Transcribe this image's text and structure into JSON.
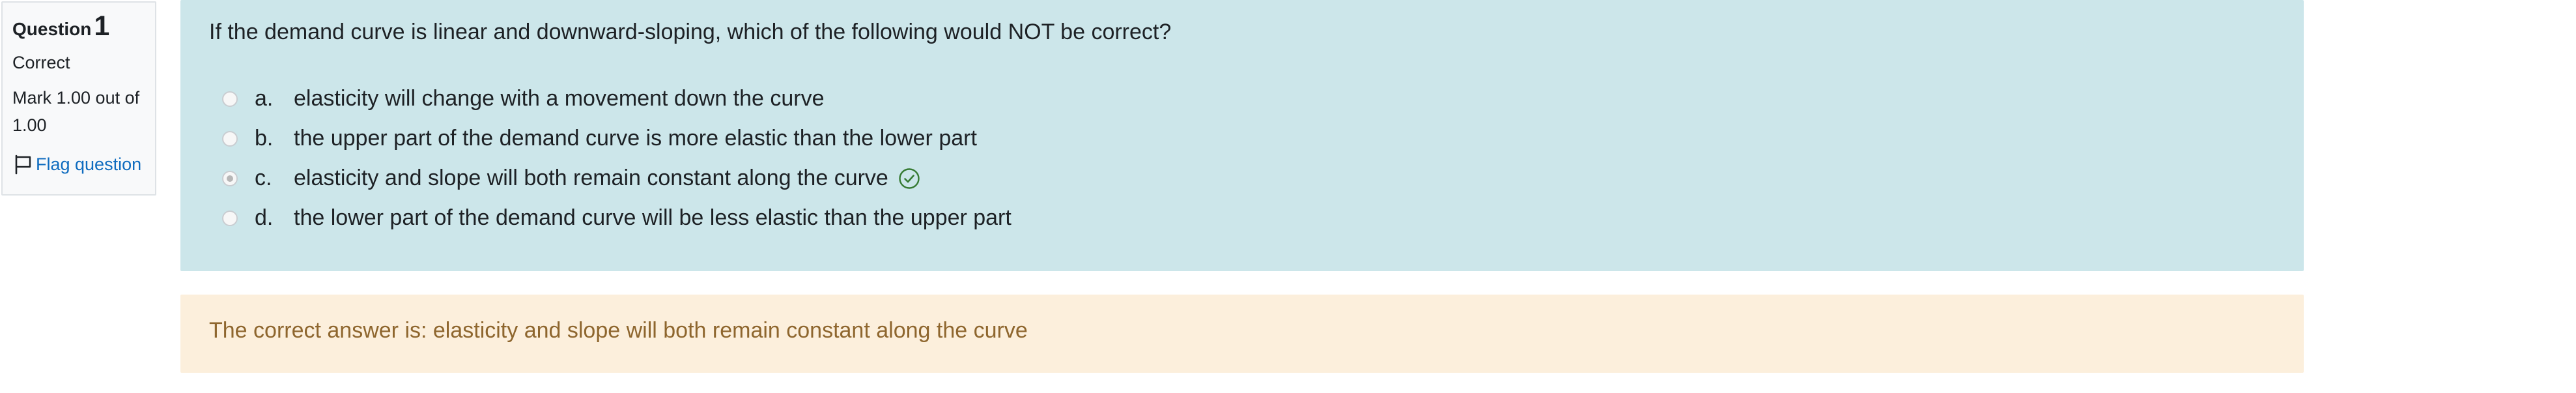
{
  "info": {
    "question_label": "Question",
    "question_number": "1",
    "state": "Correct",
    "grade": "Mark 1.00 out of 1.00",
    "flag_label": "Flag question"
  },
  "question": {
    "text": "If the demand curve is linear and downward-sloping, which of the following would NOT be correct?",
    "answers": [
      {
        "letter": "a.",
        "text": "elasticity will change with a movement down the curve",
        "selected": false,
        "correct": false
      },
      {
        "letter": "b.",
        "text": "the upper part of the demand curve is more elastic than the lower part",
        "selected": false,
        "correct": false
      },
      {
        "letter": "c.",
        "text": "elasticity and slope will both remain constant along the curve",
        "selected": true,
        "correct": true
      },
      {
        "letter": "d.",
        "text": "the lower part of the demand curve will be less elastic than the upper part",
        "selected": false,
        "correct": false
      }
    ]
  },
  "feedback": {
    "right_answer": "The correct answer is: elasticity and slope will both remain constant along the curve"
  },
  "icons": {
    "flag": "flag-icon",
    "correct": "check-circle-icon"
  },
  "colors": {
    "formulation_bg": "#cce6ea",
    "feedback_bg": "#fcefdc",
    "feedback_text": "#8e662e",
    "link": "#0f6cbf",
    "correct_green": "#357a32"
  }
}
